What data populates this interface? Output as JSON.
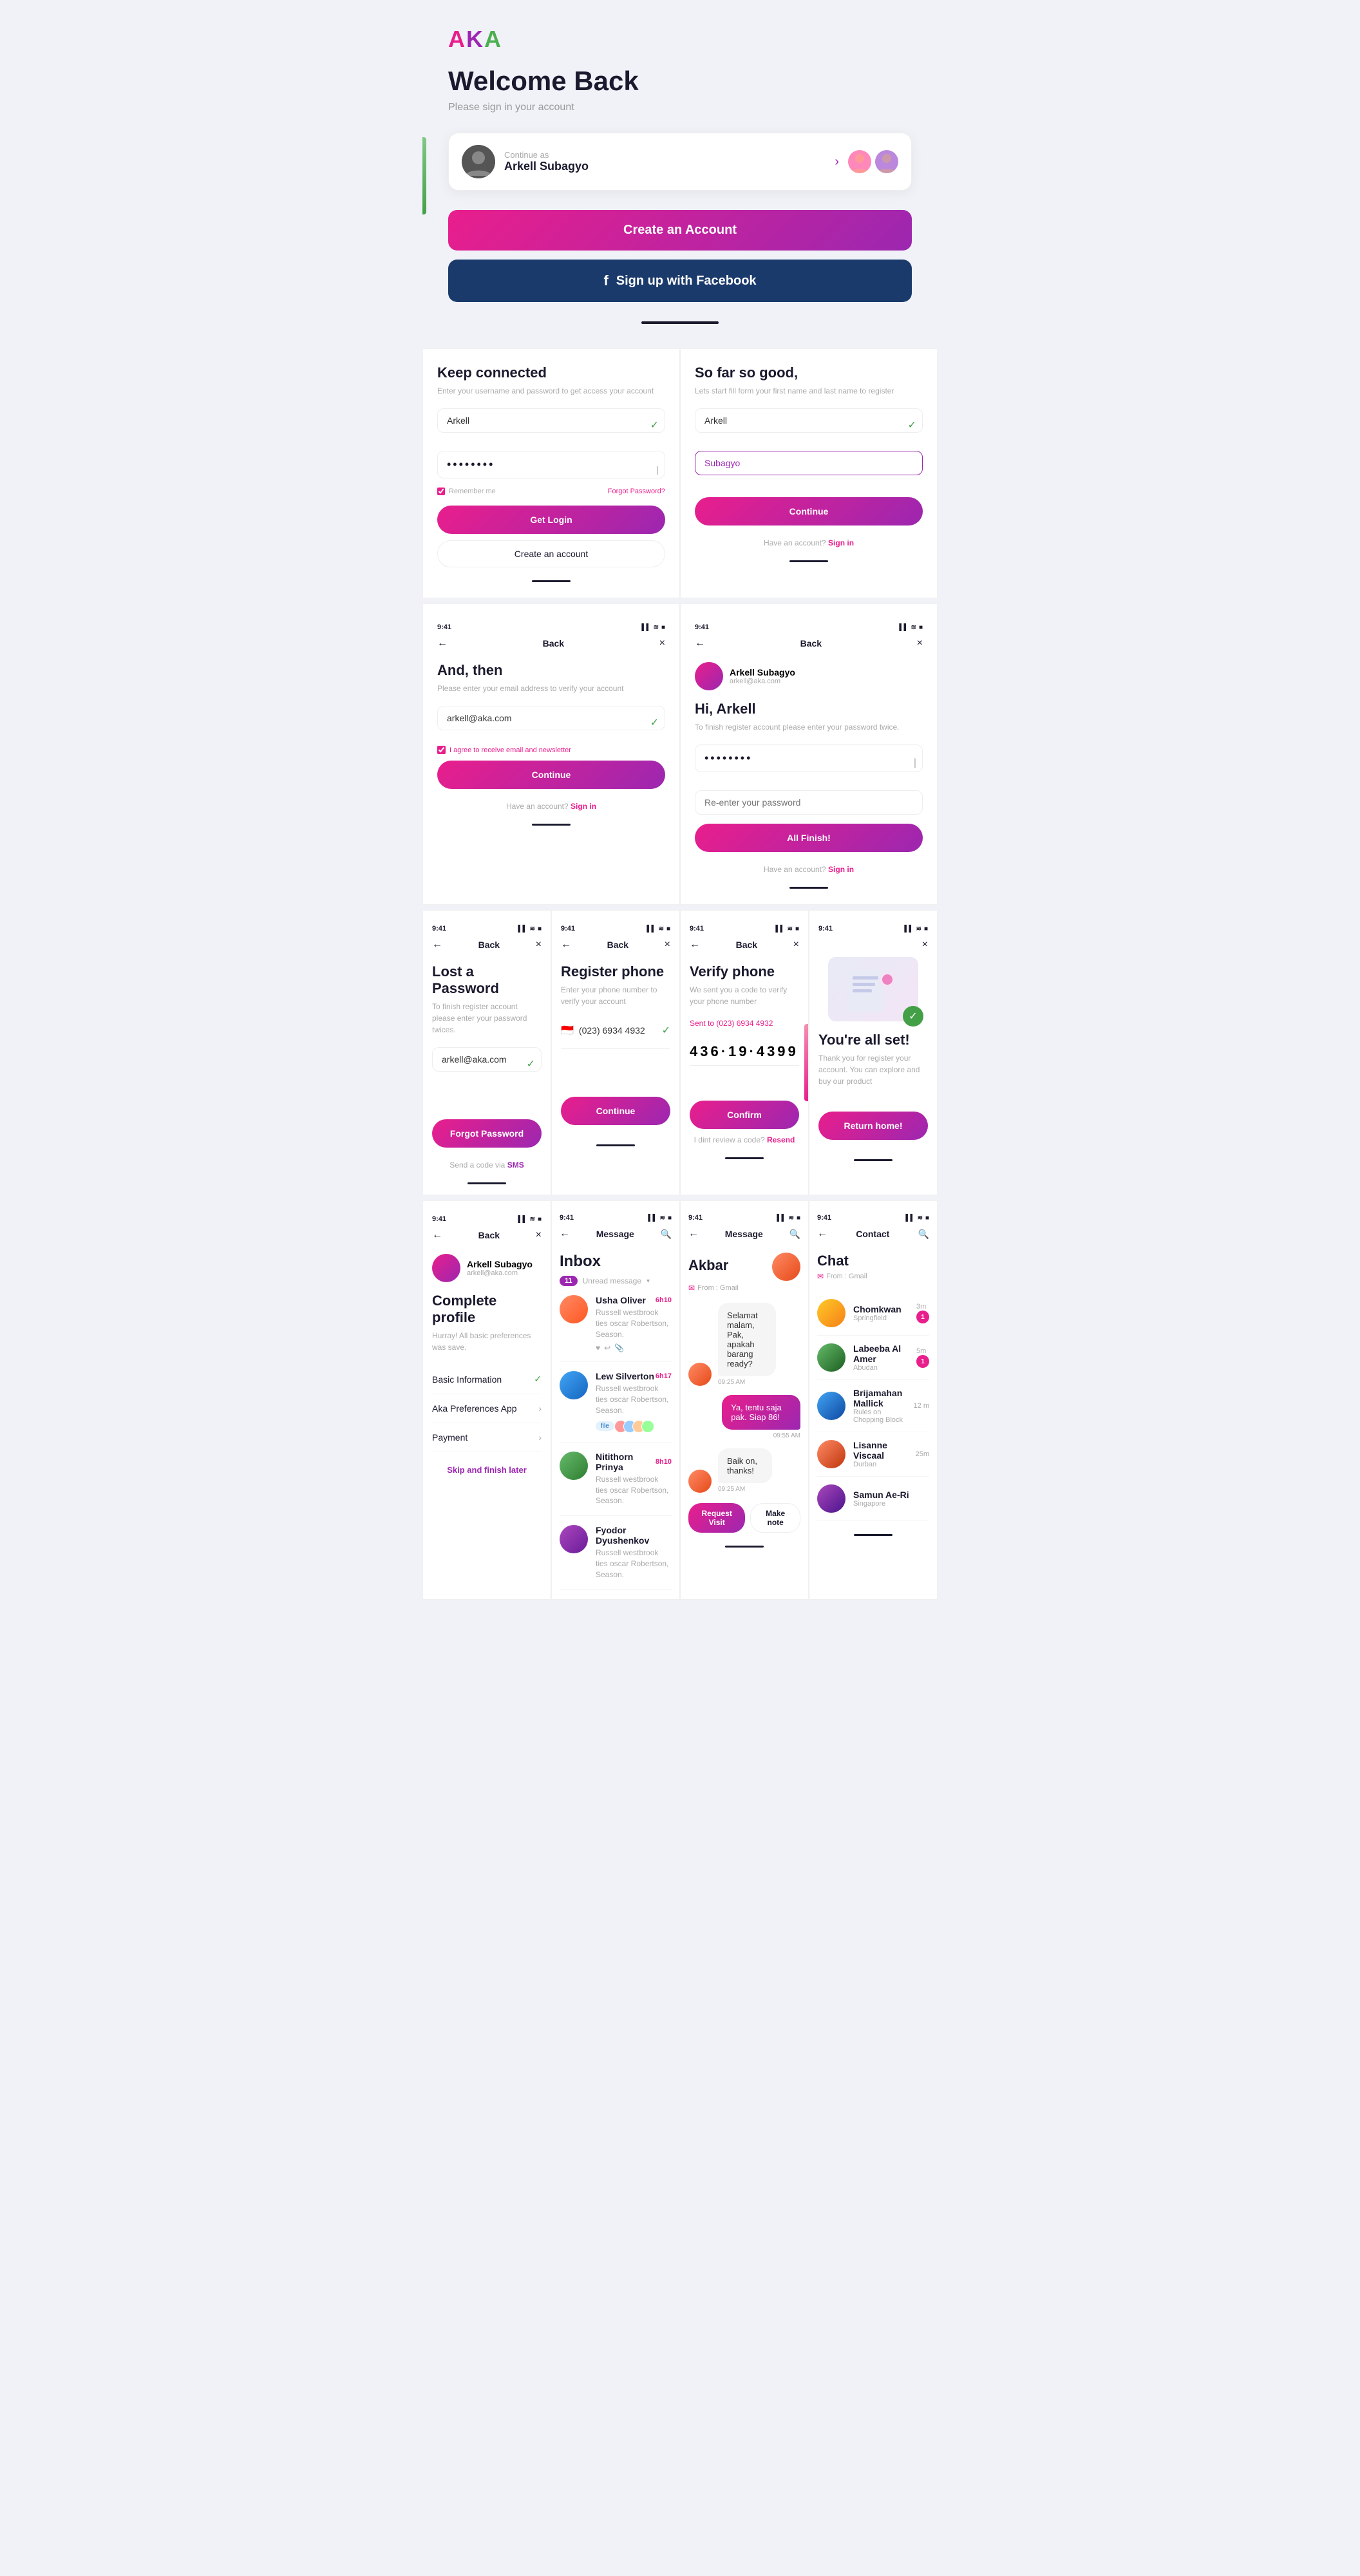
{
  "app": {
    "name": "AKA",
    "logo_a1": "A",
    "logo_k": "K",
    "logo_a2": "A"
  },
  "welcome": {
    "title": "Welcome Back",
    "subtitle": "Please sign in your account",
    "continue_as": "Continue as",
    "user_name": "Arkell Subagyo",
    "create_account_btn": "Create an Account",
    "facebook_btn": "Sign up with Facebook"
  },
  "screens": {
    "keep_connected": {
      "title": "Keep connected",
      "sub": "Enter your username and password to get access your account",
      "username_placeholder": "Arkell",
      "password_value": "••••••••",
      "remember_me": "Remember me",
      "forgot_password": "Forgot Password?",
      "login_btn": "Get Login",
      "create_account_btn": "Create an account"
    },
    "so_far_so_good": {
      "title": "So far so good,",
      "sub": "Lets start fill form your first name and last name to register",
      "first_name": "Arkell",
      "last_name": "Subagyo",
      "continue_btn": "Continue",
      "have_account": "Have an account?",
      "sign_in": "Sign in"
    },
    "and_then": {
      "title": "And, then",
      "sub": "Please enter your email address to verify your account",
      "email_placeholder": "arkell@aka.com",
      "checkbox_label": "I agree to receive email and newsletter",
      "continue_btn": "Continue",
      "have_account": "Have an account?",
      "sign_in": "Sign in"
    },
    "hi_arkell": {
      "title": "Hi, Arkell",
      "sub": "To finish register account please enter your password twice.",
      "user_name": "Arkell Subagyo",
      "user_email": "arkell@aka.com",
      "password_value": "••••••••",
      "confirm_placeholder": "Re-enter your password",
      "finish_btn": "All Finish!",
      "have_account": "Have an account?",
      "sign_in": "Sign in"
    },
    "lost_password": {
      "title": "Lost a Password",
      "sub": "To finish register account please enter your password twices.",
      "email_placeholder": "arkell@aka.com",
      "forgot_btn": "Forgot Password",
      "send_code": "Send a code via",
      "sms": "SMS"
    },
    "register_phone": {
      "title": "Register phone",
      "sub": "Enter your phone number to verify your account",
      "flag": "🇮🇩",
      "phone_number": "(023) 6934 4932",
      "continue_btn": "Continue"
    },
    "verify_phone": {
      "title": "Verify phone",
      "sub": "We sent you a code to verify your phone number",
      "sent_to": "Sent to (023) 6934 4932",
      "code_value": "436·19·4399",
      "confirm_btn": "Confirm",
      "resend_text": "I dint review a code?",
      "resend_link": "Resend"
    },
    "all_set": {
      "title": "You're all set!",
      "sub": "Thank you for register your account. You can explore and buy our product",
      "return_btn": "Return home!"
    },
    "complete_profile": {
      "title": "Complete profile",
      "sub": "Hurray! All basic preferences was save.",
      "user_name": "Arkell Subagyo",
      "user_email": "arkell@aka.com",
      "items": [
        {
          "label": "Basic Information",
          "done": true
        },
        {
          "label": "Aka Preferences App",
          "done": false
        },
        {
          "label": "Payment",
          "done": false
        }
      ],
      "skip_link": "Skip and finish later"
    },
    "inbox": {
      "title": "Inbox",
      "unread_count": "11",
      "unread_label": "Unread message",
      "messages": [
        {
          "name": "Usha Oliver",
          "preview": "Russell westbrook ties oscar Robertson, Season.",
          "time": "6h10",
          "avatar_class": "usha"
        },
        {
          "name": "Lew Silverton",
          "preview": "Russell westbrook ties oscar Robertson, Season.",
          "time": "6h17",
          "avatar_class": "lew",
          "has_file": true
        },
        {
          "name": "Nitithorn Prinya",
          "preview": "Russell westbrook ties oscar Robertson, Season.",
          "time": "8h10",
          "avatar_class": "nitithorn"
        },
        {
          "name": "Fyodor Dyushenkov",
          "preview": "Russell westbrook ties oscar Robertson, Season.",
          "time": "",
          "avatar_class": "fyodor"
        }
      ]
    },
    "message_akbar": {
      "title": "Akbar",
      "from_gmail": "From : Gmail",
      "messages": [
        {
          "side": "left",
          "text": "Selamat malam, Pak, apakah barang ready?",
          "time": "09:25 AM",
          "avatar_class": "akbar"
        },
        {
          "side": "right",
          "text": "Ya, tentu saja pak. Siap 86!",
          "time": "09:55 AM"
        },
        {
          "side": "left",
          "text": "Baik on, thanks!",
          "time": "09:25 AM",
          "avatar_class": "akbar"
        }
      ],
      "request_visit_btn": "Request Visit",
      "make_note_btn": "Make note"
    },
    "chat": {
      "title": "Chat",
      "from_gmail": "From : Gmail",
      "contacts": [
        {
          "name": "Chomkwan",
          "location": "Springfield",
          "time": "3m",
          "avatar_class": "chomkwan",
          "unread": 1
        },
        {
          "name": "Labeeba Al Amer",
          "location": "Abudan",
          "time": "5m",
          "avatar_class": "labeeba",
          "unread": 1
        },
        {
          "name": "Brijamahan Mallick",
          "location": "Rules on Chopping Block",
          "time": "12 m",
          "avatar_class": "brija"
        },
        {
          "name": "Lisanne Viscaal",
          "location": "Durban",
          "time": "25m",
          "avatar_class": "lisanne"
        },
        {
          "name": "Samun Ae-Ri",
          "location": "Singapore",
          "time": "",
          "avatar_class": "samun"
        }
      ]
    }
  },
  "nav": {
    "back": "←",
    "close": "×",
    "back_label": "Back",
    "message_label": "Message",
    "contact_label": "Contact",
    "search_icon": "🔍"
  },
  "status_bar": {
    "time": "9:41",
    "icons": "▌▌ ≋ ■"
  }
}
